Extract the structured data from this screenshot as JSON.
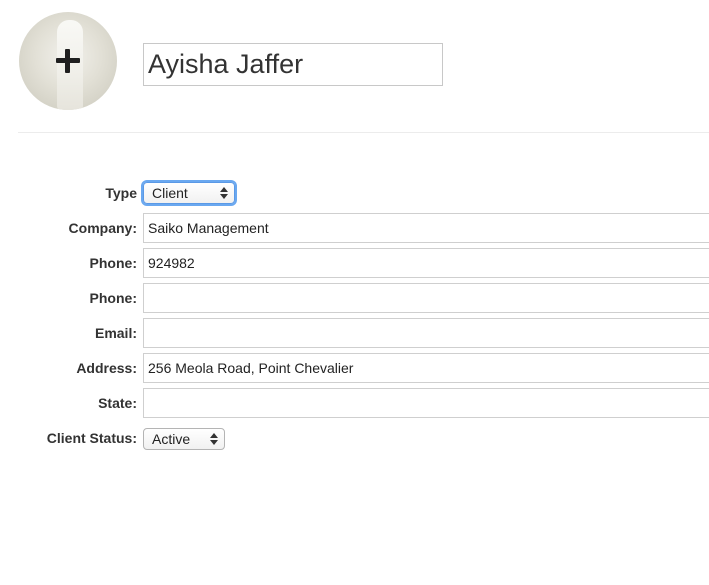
{
  "header": {
    "avatar_icon": "add-photo-plus-icon",
    "name": "Ayisha Jaffer"
  },
  "form": {
    "type": {
      "label": "Type",
      "value": "Client"
    },
    "company": {
      "label": "Company:",
      "value": "Saiko Management"
    },
    "phone1": {
      "label": "Phone:",
      "value": "924982"
    },
    "phone2": {
      "label": "Phone:",
      "value": ""
    },
    "email": {
      "label": "Email:",
      "value": ""
    },
    "address": {
      "label": "Address:",
      "value": "256 Meola Road, Point Chevalier"
    },
    "state": {
      "label": "State:",
      "value": ""
    },
    "client_status": {
      "label": "Client Status:",
      "value": "Active"
    }
  },
  "colors": {
    "focus_ring": "#6aa8f0",
    "border": "#cfcfcf",
    "label_text": "#333333"
  }
}
